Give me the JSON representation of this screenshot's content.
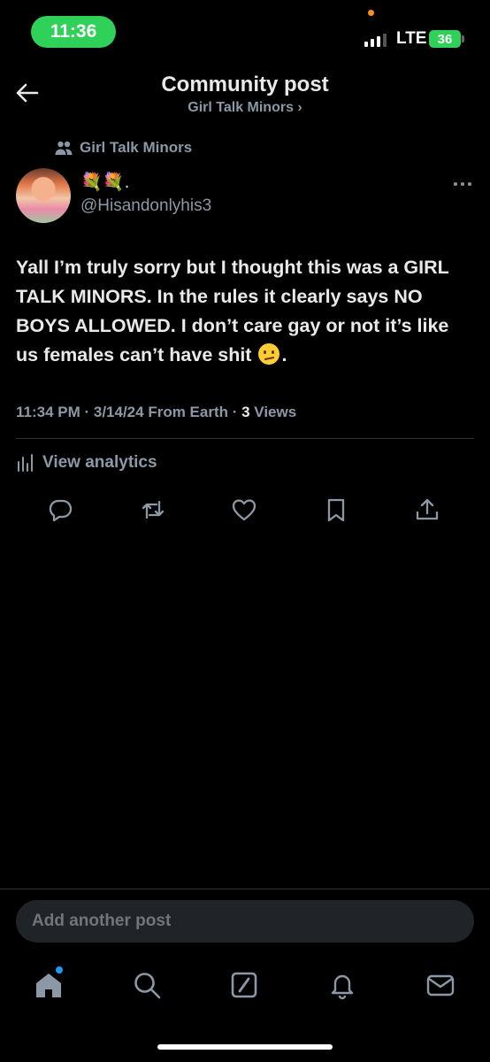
{
  "status_bar": {
    "time": "11:36",
    "network": "LTE",
    "battery": "36"
  },
  "header": {
    "title": "Community post",
    "subtitle": "Girl Talk Minors ›",
    "back_icon": "arrow-left-icon"
  },
  "post": {
    "community": "Girl Talk Minors",
    "display_name": "💐💐.",
    "handle": "@Hisandonlyhis3",
    "text_before_emoji": "Yall I’m truly sorry but I thought this was a GIRL TALK MINORS. In the rules it clearly says NO BOYS ALLOWED. I don’t care gay or not it’s like us females can’t have shit",
    "emoji": "confused-face",
    "text_after_emoji": ".",
    "timestamp": "11:34 PM · 3/14/24 From Earth · ",
    "views_count": "3",
    "views_label": " Views",
    "analytics_label": "View analytics"
  },
  "actions": [
    "reply-icon",
    "repost-icon",
    "like-icon",
    "bookmark-icon",
    "share-icon"
  ],
  "compose": {
    "placeholder": "Add another post"
  },
  "tab_bar": [
    "home-icon",
    "search-icon",
    "grok-icon",
    "notifications-icon",
    "messages-icon"
  ],
  "colors": {
    "background": "#000000",
    "text": "#e7e9ea",
    "secondary": "#8b98a5",
    "accent": "#1d9bf0",
    "status_green": "#2fd158"
  }
}
